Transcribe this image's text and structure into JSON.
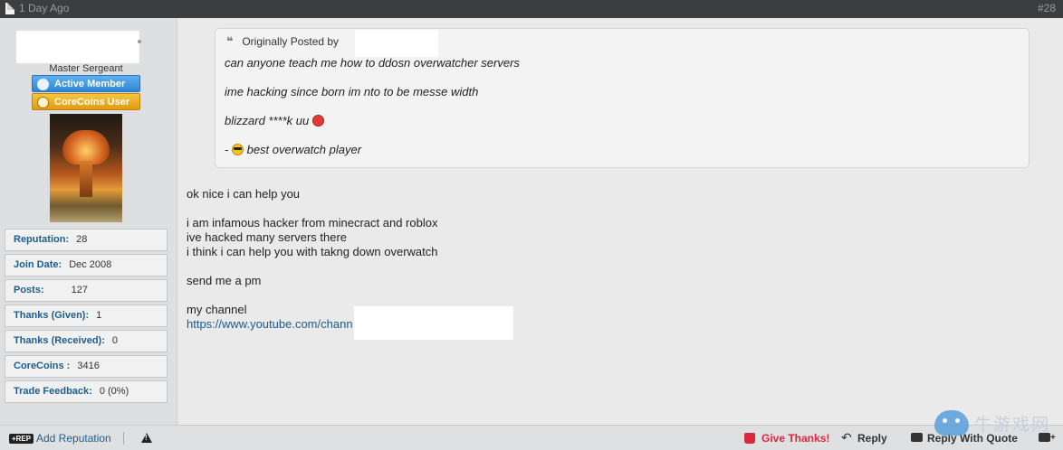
{
  "topbar": {
    "date": "1 Day Ago",
    "post_number": "#28"
  },
  "user": {
    "rank": "Master Sergeant",
    "badges": [
      "Active Member",
      "CoreCoins User"
    ],
    "stats": [
      {
        "label": "Reputation:",
        "value": "28"
      },
      {
        "label": "Join Date:",
        "value": "Dec 2008"
      },
      {
        "label": "Posts:",
        "value": "127"
      },
      {
        "label": "Thanks (Given):",
        "value": "1"
      },
      {
        "label": "Thanks (Received):",
        "value": "0"
      },
      {
        "label": "CoreCoins :",
        "value": "3416"
      },
      {
        "label": "Trade Feedback:",
        "value": "0 (0%)"
      }
    ]
  },
  "quote": {
    "header": "Originally Posted by",
    "lines": [
      "can anyone teach me how to ddosn overwatcher servers",
      "ime hacking since born im nto to be messe width",
      "blizzard ****k uu",
      "best overwatch player"
    ],
    "sig_prefix": "-"
  },
  "post": {
    "lines": [
      "ok nice i can help you",
      "i am infamous hacker from minecract and roblox",
      "ive hacked many servers there",
      "i think i can help you with takng down overwatch",
      "send me a pm",
      "my channel"
    ],
    "link": "https://www.youtube.com/chann"
  },
  "footer": {
    "rep_badge": "+REP",
    "add_reputation": "Add Reputation",
    "give_thanks": "Give Thanks!",
    "reply": "Reply",
    "reply_with_quote": "Reply With Quote",
    "multi_quote": "+"
  },
  "watermark": {
    "text": "牛游戏网"
  }
}
